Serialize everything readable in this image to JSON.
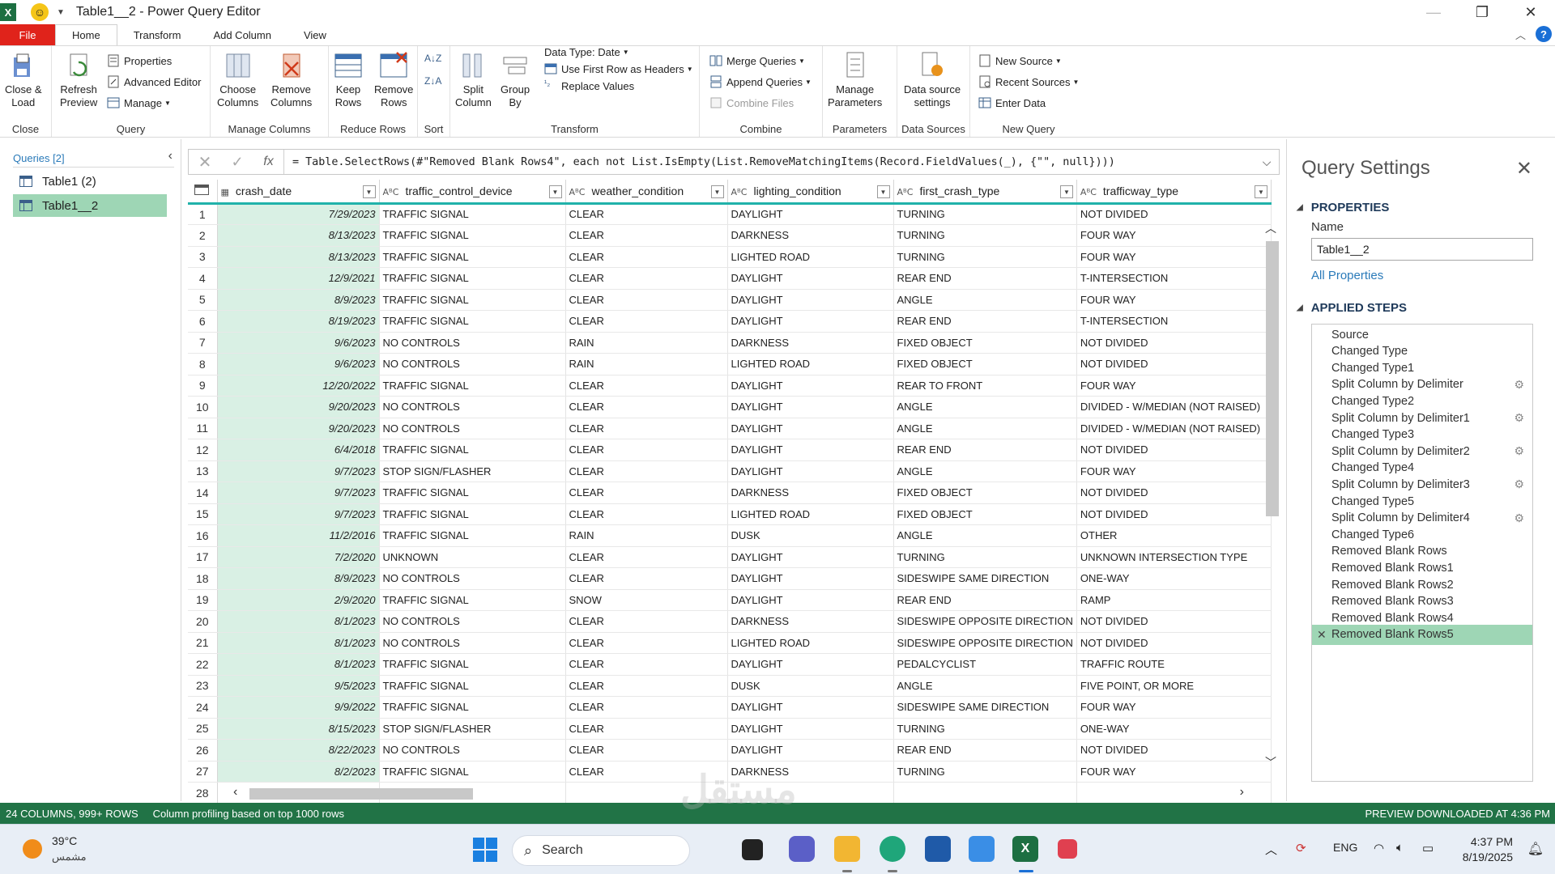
{
  "titlebar": {
    "app_icon": "X",
    "title": "Table1__2 - Power Query Editor"
  },
  "tabs": [
    "File",
    "Home",
    "Transform",
    "Add Column",
    "View"
  ],
  "ribbon": {
    "close_load": "Close &\nLoad",
    "refresh_preview": "Refresh\nPreview",
    "properties": "Properties",
    "advanced_editor": "Advanced Editor",
    "manage": "Manage",
    "choose_columns": "Choose\nColumns",
    "remove_columns": "Remove\nColumns",
    "keep_rows": "Keep\nRows",
    "remove_rows": "Remove\nRows",
    "split_column": "Split\nColumn",
    "group_by": "Group\nBy",
    "data_type": "Data Type: Date",
    "use_first_row": "Use First Row as Headers",
    "replace_values": "Replace Values",
    "merge_queries": "Merge Queries",
    "append_queries": "Append Queries",
    "combine_files": "Combine Files",
    "manage_parameters": "Manage\nParameters",
    "data_source_settings": "Data source\nsettings",
    "new_source": "New Source",
    "recent_sources": "Recent Sources",
    "enter_data": "Enter Data",
    "group_labels": {
      "close": "Close",
      "query": "Query",
      "manage_columns": "Manage Columns",
      "reduce_rows": "Reduce Rows",
      "sort": "Sort",
      "transform": "Transform",
      "combine": "Combine",
      "parameters": "Parameters",
      "data_sources": "Data Sources",
      "new_query": "New Query"
    }
  },
  "queries": {
    "header": "Queries [2]",
    "items": [
      "Table1 (2)",
      "Table1__2"
    ]
  },
  "formula": {
    "text": "= Table.SelectRows(#\"Removed Blank Rows4\", each not List.IsEmpty(List.RemoveMatchingItems(Record.FieldValues(_), {\"\", null})))"
  },
  "grid": {
    "columns": [
      {
        "name": "crash_date",
        "type": "date"
      },
      {
        "name": "traffic_control_device",
        "type": "ABC"
      },
      {
        "name": "weather_condition",
        "type": "ABC"
      },
      {
        "name": "lighting_condition",
        "type": "ABC"
      },
      {
        "name": "first_crash_type",
        "type": "ABC"
      },
      {
        "name": "trafficway_type",
        "type": "ABC"
      }
    ],
    "rows": [
      [
        "1",
        "7/29/2023",
        "TRAFFIC SIGNAL",
        "CLEAR",
        "DAYLIGHT",
        "TURNING",
        "NOT DIVIDED"
      ],
      [
        "2",
        "8/13/2023",
        "TRAFFIC SIGNAL",
        "CLEAR",
        "DARKNESS",
        "TURNING",
        "FOUR WAY"
      ],
      [
        "3",
        "8/13/2023",
        "TRAFFIC SIGNAL",
        "CLEAR",
        " LIGHTED ROAD",
        "TURNING",
        "FOUR WAY"
      ],
      [
        "4",
        "12/9/2021",
        "TRAFFIC SIGNAL",
        "CLEAR",
        "DAYLIGHT",
        "REAR END",
        "T-INTERSECTION"
      ],
      [
        "5",
        "8/9/2023",
        "TRAFFIC SIGNAL",
        "CLEAR",
        "DAYLIGHT",
        "ANGLE",
        "FOUR WAY"
      ],
      [
        "6",
        "8/19/2023",
        "TRAFFIC SIGNAL",
        "CLEAR",
        "DAYLIGHT",
        "REAR END",
        "T-INTERSECTION"
      ],
      [
        "7",
        "9/6/2023",
        "NO CONTROLS",
        "RAIN",
        "DARKNESS",
        "FIXED OBJECT",
        "NOT DIVIDED"
      ],
      [
        "8",
        "9/6/2023",
        "NO CONTROLS",
        "RAIN",
        " LIGHTED ROAD",
        "FIXED OBJECT",
        "NOT DIVIDED"
      ],
      [
        "9",
        "12/20/2022",
        "TRAFFIC SIGNAL",
        "CLEAR",
        "DAYLIGHT",
        "REAR TO FRONT",
        "FOUR WAY"
      ],
      [
        "10",
        "9/20/2023",
        "NO CONTROLS",
        "CLEAR",
        "DAYLIGHT",
        "ANGLE",
        "DIVIDED - W/MEDIAN (NOT RAISED)"
      ],
      [
        "11",
        "9/20/2023",
        "NO CONTROLS",
        "CLEAR",
        "DAYLIGHT",
        "ANGLE",
        "DIVIDED - W/MEDIAN (NOT RAISED)"
      ],
      [
        "12",
        "6/4/2018",
        "TRAFFIC SIGNAL",
        "CLEAR",
        "DAYLIGHT",
        "REAR END",
        "NOT DIVIDED"
      ],
      [
        "13",
        "9/7/2023",
        "STOP SIGN/FLASHER",
        "CLEAR",
        "DAYLIGHT",
        "ANGLE",
        "FOUR WAY"
      ],
      [
        "14",
        "9/7/2023",
        "TRAFFIC SIGNAL",
        "CLEAR",
        "DARKNESS",
        "FIXED OBJECT",
        "NOT DIVIDED"
      ],
      [
        "15",
        "9/7/2023",
        "TRAFFIC SIGNAL",
        "CLEAR",
        " LIGHTED ROAD",
        "FIXED OBJECT",
        "NOT DIVIDED"
      ],
      [
        "16",
        "11/2/2016",
        "TRAFFIC SIGNAL",
        "RAIN",
        "DUSK",
        "ANGLE",
        "OTHER"
      ],
      [
        "17",
        "7/2/2020",
        "UNKNOWN",
        "CLEAR",
        "DAYLIGHT",
        "TURNING",
        "UNKNOWN INTERSECTION TYPE"
      ],
      [
        "18",
        "8/9/2023",
        "NO CONTROLS",
        "CLEAR",
        "DAYLIGHT",
        "SIDESWIPE SAME DIRECTION",
        "ONE-WAY"
      ],
      [
        "19",
        "2/9/2020",
        "TRAFFIC SIGNAL",
        "SNOW",
        "DAYLIGHT",
        "REAR END",
        "RAMP"
      ],
      [
        "20",
        "8/1/2023",
        "NO CONTROLS",
        "CLEAR",
        "DARKNESS",
        "SIDESWIPE OPPOSITE DIRECTION",
        "NOT DIVIDED"
      ],
      [
        "21",
        "8/1/2023",
        "NO CONTROLS",
        "CLEAR",
        " LIGHTED ROAD",
        "SIDESWIPE OPPOSITE DIRECTION",
        "NOT DIVIDED"
      ],
      [
        "22",
        "8/1/2023",
        "TRAFFIC SIGNAL",
        "CLEAR",
        "DAYLIGHT",
        "PEDALCYCLIST",
        "TRAFFIC ROUTE"
      ],
      [
        "23",
        "9/5/2023",
        "TRAFFIC SIGNAL",
        "CLEAR",
        "DUSK",
        "ANGLE",
        "FIVE POINT, OR MORE"
      ],
      [
        "24",
        "9/9/2022",
        "TRAFFIC SIGNAL",
        "CLEAR",
        "DAYLIGHT",
        "SIDESWIPE SAME DIRECTION",
        "FOUR WAY"
      ],
      [
        "25",
        "8/15/2023",
        "STOP SIGN/FLASHER",
        "CLEAR",
        "DAYLIGHT",
        "TURNING",
        "ONE-WAY"
      ],
      [
        "26",
        "8/22/2023",
        "NO CONTROLS",
        "CLEAR",
        "DAYLIGHT",
        "REAR END",
        "NOT DIVIDED"
      ],
      [
        "27",
        "8/2/2023",
        "TRAFFIC SIGNAL",
        "CLEAR",
        "DARKNESS",
        "TURNING",
        "FOUR WAY"
      ],
      [
        "28",
        "",
        "",
        "",
        "",
        "",
        ""
      ]
    ]
  },
  "query_settings": {
    "title": "Query Settings",
    "properties_label": "PROPERTIES",
    "name_label": "Name",
    "name_value": "Table1__2",
    "all_properties": "All Properties",
    "applied_steps_label": "APPLIED STEPS",
    "steps": [
      {
        "label": "Source",
        "gear": false
      },
      {
        "label": "Changed Type",
        "gear": false
      },
      {
        "label": "Changed Type1",
        "gear": false
      },
      {
        "label": "Split Column by Delimiter",
        "gear": true
      },
      {
        "label": "Changed Type2",
        "gear": false
      },
      {
        "label": "Split Column by Delimiter1",
        "gear": true
      },
      {
        "label": "Changed Type3",
        "gear": false
      },
      {
        "label": "Split Column by Delimiter2",
        "gear": true
      },
      {
        "label": "Changed Type4",
        "gear": false
      },
      {
        "label": "Split Column by Delimiter3",
        "gear": true
      },
      {
        "label": "Changed Type5",
        "gear": false
      },
      {
        "label": "Split Column by Delimiter4",
        "gear": true
      },
      {
        "label": "Changed Type6",
        "gear": false
      },
      {
        "label": "Removed Blank Rows",
        "gear": false
      },
      {
        "label": "Removed Blank Rows1",
        "gear": false
      },
      {
        "label": "Removed Blank Rows2",
        "gear": false
      },
      {
        "label": "Removed Blank Rows3",
        "gear": false
      },
      {
        "label": "Removed Blank Rows4",
        "gear": false
      },
      {
        "label": "Removed Blank Rows5",
        "gear": false,
        "selected": true
      }
    ]
  },
  "status": {
    "counts": "24 COLUMNS, 999+ ROWS",
    "profiling": "Column profiling based on top 1000 rows",
    "preview": "PREVIEW DOWNLOADED AT 4:36 PM"
  },
  "taskbar": {
    "temperature": "39°C",
    "weather": "مشمس",
    "search": "Search",
    "language": "ENG",
    "time": "4:37 PM",
    "date": "8/19/2025"
  },
  "colors": {
    "file_tab": "#e0231b",
    "status_bar": "#217346",
    "selection": "#9ed6b5",
    "header_rule": "#20b2aa"
  }
}
